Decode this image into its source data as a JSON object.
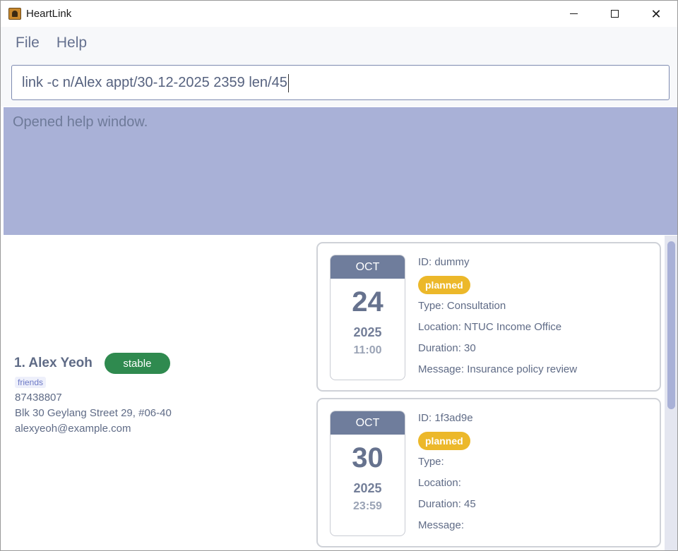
{
  "window": {
    "title": "HeartLink"
  },
  "menu": {
    "items": [
      "File",
      "Help"
    ]
  },
  "command": {
    "value": "link -c n/Alex appt/30-12-2025 2359 len/45"
  },
  "result": {
    "message": "Opened help window."
  },
  "person": {
    "name": "1. Alex Yeoh",
    "status": "stable",
    "tag": "friends",
    "phone": "87438807",
    "address": "Blk 30 Geylang Street 29, #06-40",
    "email": "alexyeoh@example.com"
  },
  "appointments": [
    {
      "month": "OCT",
      "day": "24",
      "year": "2025",
      "time": "11:00",
      "id": "ID: dummy",
      "status": "planned",
      "type": "Type: Consultation",
      "location": "Location: NTUC Income Office",
      "duration": "Duration: 30",
      "message": "Message: Insurance policy review"
    },
    {
      "month": "OCT",
      "day": "30",
      "year": "2025",
      "time": "23:59",
      "id": "ID: 1f3ad9e",
      "status": "planned",
      "type": "Type:",
      "location": "Location:",
      "duration": "Duration: 45",
      "message": "Message:"
    }
  ],
  "colors": {
    "result_bg": "#a9b1d7",
    "status_stable": "#2f8a4f",
    "status_planned": "#ecb82a",
    "calendar_header": "#6f7d9c"
  }
}
